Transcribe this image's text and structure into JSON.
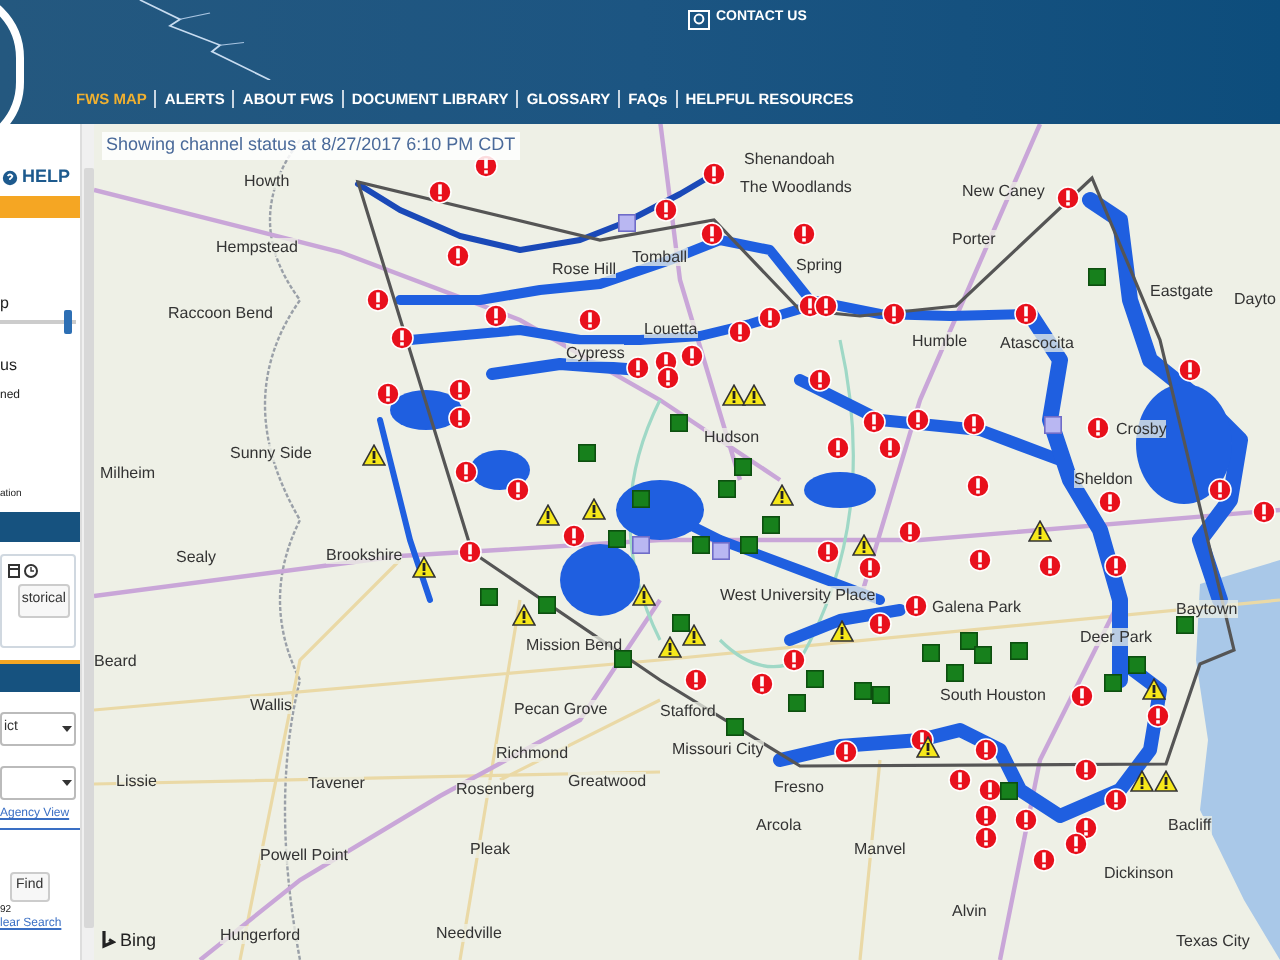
{
  "header": {
    "contact": "CONTACT US",
    "nav": [
      {
        "label": "FWS MAP",
        "selected": true
      },
      {
        "label": "ALERTS",
        "selected": false
      },
      {
        "label": "ABOUT FWS",
        "selected": false
      },
      {
        "label": "DOCUMENT LIBRARY",
        "selected": false
      },
      {
        "label": "GLOSSARY",
        "selected": false
      },
      {
        "label": "FAQs",
        "selected": false
      },
      {
        "label": "HELPFUL RESOURCES",
        "selected": false
      }
    ]
  },
  "sidebar": {
    "help": "HELP",
    "texts": [
      "p",
      "us",
      "ned",
      "ation"
    ],
    "slider": {
      "level": 0.95
    },
    "historical_button": "storical",
    "dropdowns": [
      {
        "kind": "select",
        "value": "ict"
      },
      {
        "kind": "select"
      }
    ],
    "agency_link": "Agency View",
    "find_button": "Find",
    "count": "92",
    "clear_link": "lear Search"
  },
  "map": {
    "status": "Showing channel status at 8/27/2017 6:10 PM CDT",
    "attribution": "Bing",
    "labels": [
      "Shenandoah",
      "The Woodlands",
      "New Caney",
      "Porter",
      "Howth",
      "Hempstead",
      "Rose Hill",
      "Tomball",
      "Spring",
      "Raccoon Bend",
      "Louetta",
      "Cypress",
      "Humble",
      "Atascocita",
      "Eastgate",
      "Dayto",
      "Hudson",
      "Sunny Side",
      "Milheim",
      "Crosby",
      "Sheldon",
      "Sealy",
      "Brookshire",
      "West University Place",
      "Galena Park",
      "Deer Park",
      "South Houston",
      "Baytown",
      "Mission Bend",
      "Beard",
      "Wallis",
      "Pecan Grove",
      "Richmond",
      "Lissie",
      "Tavener",
      "Rosenberg",
      "Greatwood",
      "Stafford",
      "Missouri City",
      "Fresno",
      "Arcola",
      "Manvel",
      "Alvin",
      "Dickinson",
      "Bacliff",
      "Texas City",
      "Pleak",
      "Powell Point",
      "Hungerford",
      "Needville"
    ],
    "markers": [
      {
        "kind": "alert"
      },
      {
        "kind": "alert"
      },
      {
        "kind": "alert"
      },
      {
        "kind": "alert"
      },
      {
        "kind": "alert"
      },
      {
        "kind": "alert"
      },
      {
        "kind": "alert"
      },
      {
        "kind": "alert"
      },
      {
        "kind": "alert"
      },
      {
        "kind": "alert"
      },
      {
        "kind": "alert"
      },
      {
        "kind": "alert"
      },
      {
        "kind": "alert"
      },
      {
        "kind": "alert"
      },
      {
        "kind": "alert"
      },
      {
        "kind": "alert"
      },
      {
        "kind": "alert"
      },
      {
        "kind": "alert"
      },
      {
        "kind": "alert"
      },
      {
        "kind": "alert"
      },
      {
        "kind": "alert"
      },
      {
        "kind": "alert"
      },
      {
        "kind": "alert"
      },
      {
        "kind": "alert"
      },
      {
        "kind": "alert"
      },
      {
        "kind": "alert"
      },
      {
        "kind": "alert"
      },
      {
        "kind": "alert"
      },
      {
        "kind": "alert"
      },
      {
        "kind": "alert"
      },
      {
        "kind": "alert"
      },
      {
        "kind": "alert"
      },
      {
        "kind": "alert"
      },
      {
        "kind": "alert"
      },
      {
        "kind": "alert"
      },
      {
        "kind": "alert"
      },
      {
        "kind": "alert"
      },
      {
        "kind": "alert"
      },
      {
        "kind": "alert"
      },
      {
        "kind": "alert"
      },
      {
        "kind": "alert"
      },
      {
        "kind": "alert"
      },
      {
        "kind": "alert"
      },
      {
        "kind": "alert"
      },
      {
        "kind": "alert"
      },
      {
        "kind": "alert"
      },
      {
        "kind": "alert"
      },
      {
        "kind": "alert"
      },
      {
        "kind": "alert"
      },
      {
        "kind": "alert"
      },
      {
        "kind": "alert"
      },
      {
        "kind": "alert"
      },
      {
        "kind": "alert"
      },
      {
        "kind": "alert"
      },
      {
        "kind": "alert"
      },
      {
        "kind": "alert"
      },
      {
        "kind": "alert"
      },
      {
        "kind": "alert"
      },
      {
        "kind": "alert"
      },
      {
        "kind": "alert"
      },
      {
        "kind": "alert"
      },
      {
        "kind": "alert"
      },
      {
        "kind": "alert"
      },
      {
        "kind": "alert"
      },
      {
        "kind": "alert"
      },
      {
        "kind": "alert"
      },
      {
        "kind": "alert"
      },
      {
        "kind": "warning"
      },
      {
        "kind": "warning"
      },
      {
        "kind": "warning"
      },
      {
        "kind": "warning"
      },
      {
        "kind": "warning"
      },
      {
        "kind": "warning"
      },
      {
        "kind": "warning"
      },
      {
        "kind": "warning"
      },
      {
        "kind": "warning"
      },
      {
        "kind": "warning"
      },
      {
        "kind": "warning"
      },
      {
        "kind": "warning"
      },
      {
        "kind": "warning"
      },
      {
        "kind": "warning"
      },
      {
        "kind": "warning"
      },
      {
        "kind": "warning"
      },
      {
        "kind": "warning"
      },
      {
        "kind": "warning"
      },
      {
        "kind": "normal"
      },
      {
        "kind": "normal"
      },
      {
        "kind": "normal"
      },
      {
        "kind": "normal"
      },
      {
        "kind": "normal"
      },
      {
        "kind": "normal"
      },
      {
        "kind": "normal"
      },
      {
        "kind": "normal"
      },
      {
        "kind": "normal"
      },
      {
        "kind": "normal"
      },
      {
        "kind": "normal"
      },
      {
        "kind": "normal"
      },
      {
        "kind": "normal"
      },
      {
        "kind": "normal"
      },
      {
        "kind": "normal"
      },
      {
        "kind": "normal"
      },
      {
        "kind": "normal"
      },
      {
        "kind": "normal"
      },
      {
        "kind": "normal"
      },
      {
        "kind": "normal"
      },
      {
        "kind": "normal"
      },
      {
        "kind": "normal"
      },
      {
        "kind": "normal"
      },
      {
        "kind": "normal"
      },
      {
        "kind": "normal"
      },
      {
        "kind": "normal"
      },
      {
        "kind": "normal"
      },
      {
        "kind": "normal"
      },
      {
        "kind": "other"
      },
      {
        "kind": "other"
      },
      {
        "kind": "other"
      },
      {
        "kind": "other"
      }
    ]
  }
}
